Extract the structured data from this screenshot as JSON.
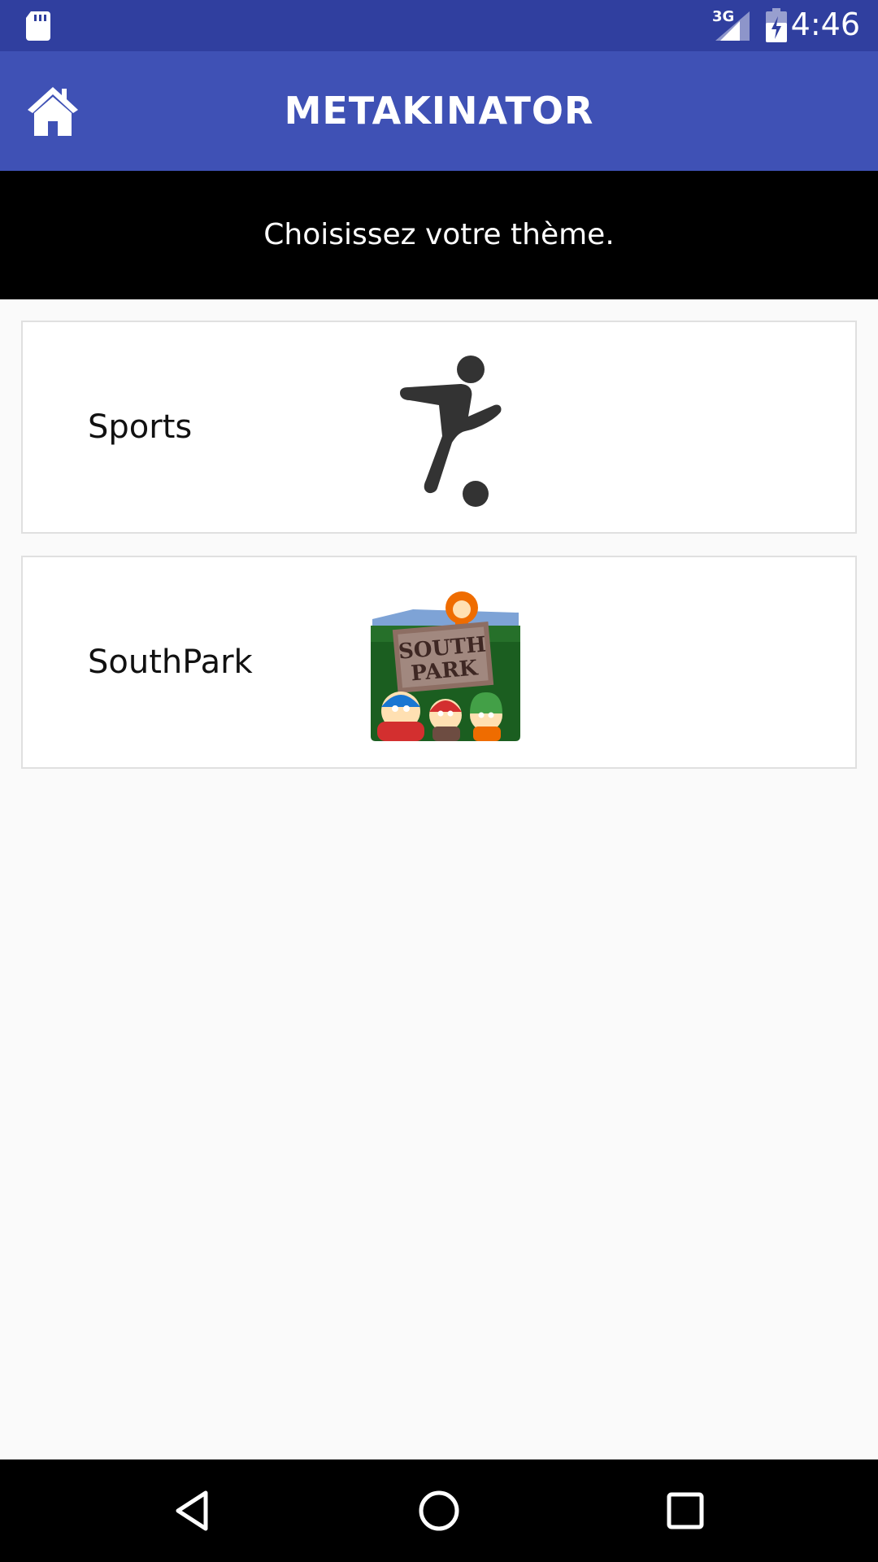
{
  "status_bar": {
    "network": "3G",
    "time": "4:46"
  },
  "app_bar": {
    "title": "METAKINATOR",
    "home_icon": "home-icon"
  },
  "subtitle": "Choisissez votre thème.",
  "themes": [
    {
      "label": "Sports",
      "icon": "soccer-player-icon"
    },
    {
      "label": "SouthPark",
      "icon": "southpark-folder-icon"
    }
  ],
  "nav_bar": {
    "back_icon": "back-triangle-icon",
    "home_icon": "home-circle-icon",
    "recents_icon": "recents-square-icon"
  },
  "colors": {
    "status_bar": "#303f9f",
    "app_bar": "#3f51b5",
    "subtitle_bg": "#000000",
    "page_bg": "#fafafa",
    "card_border": "#e0e0e0"
  }
}
